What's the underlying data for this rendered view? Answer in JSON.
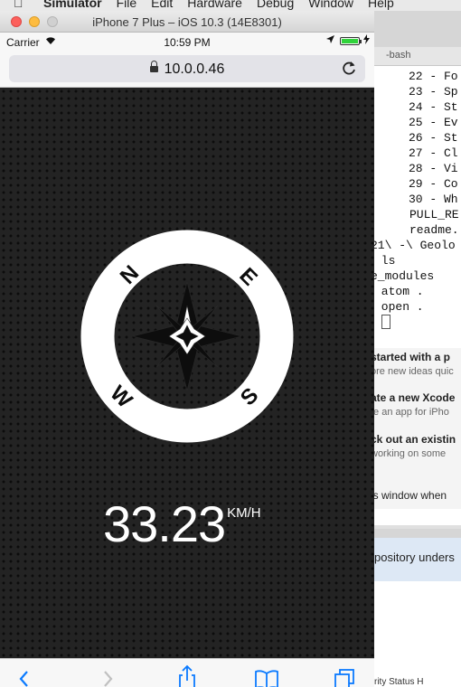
{
  "menubar": {
    "apple": "",
    "items": [
      "Simulator",
      "File",
      "Edit",
      "Hardware",
      "Debug",
      "Window",
      "Help"
    ]
  },
  "simulator": {
    "title": "iPhone 7 Plus – iOS 10.3 (14E8301)"
  },
  "statusbar": {
    "carrier": "Carrier",
    "wifi": "wifi-icon",
    "time": "10:59 PM",
    "battery_color": "#30d33b"
  },
  "browser": {
    "url": "10.0.0.46"
  },
  "compass": {
    "north": "N",
    "east": "E",
    "south": "S",
    "west": "W"
  },
  "speed": {
    "value": "33.23",
    "unit": "KM/H"
  },
  "terminal": {
    "title": "-bash",
    "lines": [
      "22 - Fo",
      "23 - Sp",
      "24 - St",
      "25 - Ev",
      "26 - St",
      "27 - Cl",
      "28 - Vi",
      "29 - Co",
      "30 - Wh",
      "PULL_RE",
      "readme.",
      "21\\ -\\ Geolo",
      " ls",
      "e_modules",
      " atom .",
      " open ."
    ]
  },
  "welcome": {
    "items": [
      {
        "heading": "started with a p",
        "sub": "ore new ideas quic"
      },
      {
        "heading": "ate a new Xcode",
        "sub": "te an app for iPho"
      },
      {
        "heading": "ck out an existin",
        "sub": "working on some"
      }
    ],
    "footer": "is window when"
  },
  "github": {
    "banner": "pository unders",
    "footer": "rity   Status   H"
  }
}
